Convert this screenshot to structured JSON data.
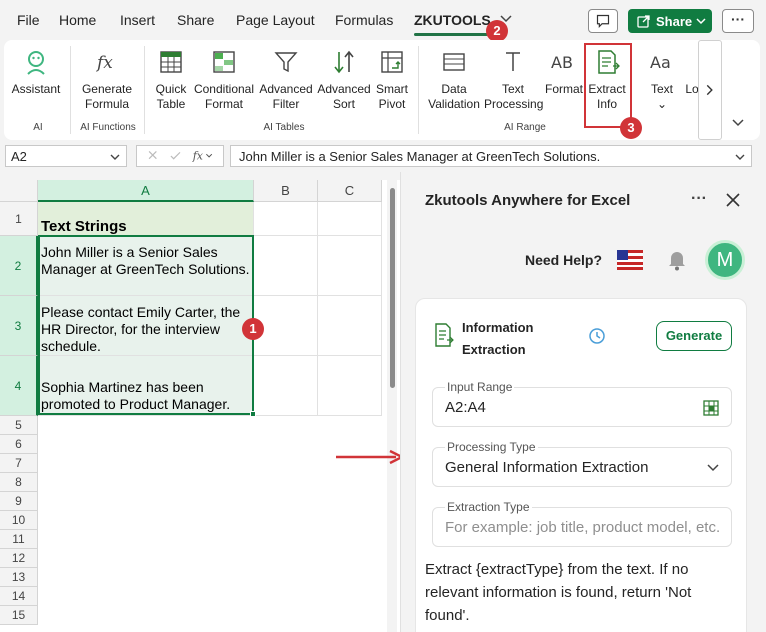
{
  "menu": {
    "items": [
      "File",
      "Home",
      "Insert",
      "Share",
      "Page Layout",
      "Formulas",
      "ZKUTOOLS"
    ],
    "share_label": "Share",
    "more_label": "···"
  },
  "badges": {
    "one": "1",
    "two": "2",
    "three": "3"
  },
  "ribbon": {
    "assistant": "Assistant",
    "generate_formula": [
      "Generate",
      "Formula"
    ],
    "quick_table": [
      "Quick",
      "Table"
    ],
    "conditional_format": [
      "Conditional",
      "Format"
    ],
    "advanced_filter": [
      "Advanced",
      "Filter"
    ],
    "advanced_sort": [
      "Advanced",
      "Sort"
    ],
    "smart_pivot": [
      "Smart",
      "Pivot"
    ],
    "data_validation": [
      "Data",
      "Validation"
    ],
    "text_processing": [
      "Text",
      "Processing"
    ],
    "format": "Format",
    "extract_info": [
      "Extract",
      "Info"
    ],
    "text": "Text",
    "lo": "Lo",
    "groups": {
      "ai": "AI",
      "ai_functions": "AI Functions",
      "ai_tables": "AI Tables",
      "ai_range": "AI Range"
    }
  },
  "formula_bar": {
    "name_box": "A2",
    "fx": "fx",
    "formula": "John Miller is a Senior Sales Manager at GreenTech Solutions."
  },
  "grid": {
    "columns": [
      "A",
      "B",
      "C"
    ],
    "rows": [
      "1",
      "2",
      "3",
      "4",
      "5",
      "6",
      "7",
      "8",
      "9",
      "10",
      "11",
      "12",
      "13",
      "14",
      "15"
    ],
    "cells": {
      "a1": "Text Strings",
      "a2": "John Miller is a Senior Sales Manager at GreenTech Solutions.",
      "a3": "Please contact Emily Carter, the HR Director, for the interview schedule.",
      "a4": "Sophia Martinez has been promoted to Product Manager."
    }
  },
  "pane": {
    "title": "Zkutools Anywhere for Excel",
    "need_help": "Need Help?",
    "avatar": "M",
    "card_title": [
      "Information",
      "Extraction"
    ],
    "generate": "Generate",
    "input_range_label": "Input Range",
    "input_range_value": "A2:A4",
    "processing_type_label": "Processing Type",
    "processing_type_value": "General Information Extraction",
    "extraction_type_label": "Extraction Type",
    "extraction_type_placeholder": "For example: job title, product model, etc.",
    "prompt": "Extract {extractType} from the text. If no relevant information is found, return 'Not found'."
  },
  "colors": {
    "accent": "#107c41",
    "badge": "#d13438",
    "avatar": "#3fb680"
  }
}
